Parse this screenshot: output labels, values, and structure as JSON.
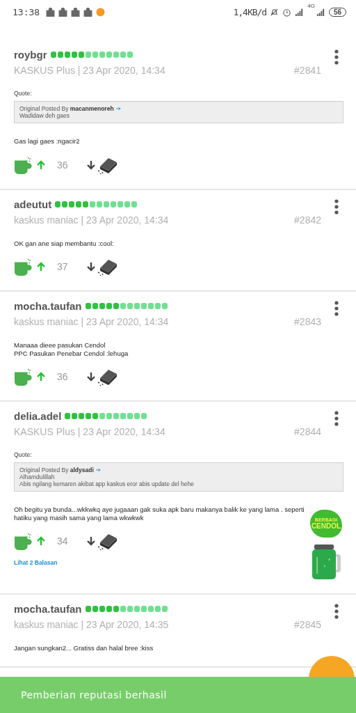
{
  "status_bar": {
    "time": "13:38",
    "network_speed": "1,4KB/d",
    "network_type": "4G",
    "battery": "56"
  },
  "posts": [
    {
      "user": "roybgr",
      "reputation": {
        "level": 0.42
      },
      "rank": "KASKUS Plus | 23 Apr 2020, 14:34",
      "number": "#2841",
      "quote": {
        "label": "Quote:",
        "prefix": "Original Posted By",
        "author": "macanmenoreh",
        "lines": [
          "Wadidaw deh gaes"
        ]
      },
      "body": [
        "Gas lagi gaes :ngacir2"
      ],
      "count": "36"
    },
    {
      "user": "adeutut",
      "reputation": {
        "level": 0.42
      },
      "rank": "kaskus maniac | 23 Apr 2020, 14:34",
      "number": "#2842",
      "body": [
        "OK gan ane siap membantu :cool:"
      ],
      "count": "37"
    },
    {
      "user": "mocha.taufan",
      "reputation": {
        "level": 0.42
      },
      "rank": "kaskus maniac | 23 Apr 2020, 14:34",
      "number": "#2843",
      "body": [
        "Manaaa dieee pasukan Cendol",
        "PPC Pasukan Penebar Cendol :lehuga"
      ],
      "count": "36"
    },
    {
      "user": "delia.adel",
      "reputation": {
        "level": 0.42
      },
      "rank": "KASKUS Plus | 23 Apr 2020, 14:34",
      "number": "#2844",
      "quote": {
        "label": "Quote:",
        "prefix": "Original Posted By",
        "author": "aldysadi",
        "lines": [
          "Alhamdulillah",
          "Abis ngilang kemaren akibat app kaskus eror abis update del hehe"
        ]
      },
      "body": [
        "Oh begitu ya bunda...wkkwkq aye jugaaan gak suka apk baru makanya balik ke yang lama . seperti hatiku yang masih sama yang lama wkwkwk"
      ],
      "count": "34",
      "replies": "Lihat 2 Balasan",
      "sticker": {
        "line1": "BERBAGI",
        "line2": "CENDOL"
      }
    },
    {
      "user": "mocha.taufan",
      "reputation": {
        "level": 0.42
      },
      "rank": "kaskus maniac | 23 Apr 2020, 14:35",
      "number": "#2845",
      "body": [
        "Jangan sungkan2... Gratiss dan halal bree :kiss"
      ]
    }
  ],
  "toast": {
    "message": "Pemberian reputasi berhasil"
  }
}
